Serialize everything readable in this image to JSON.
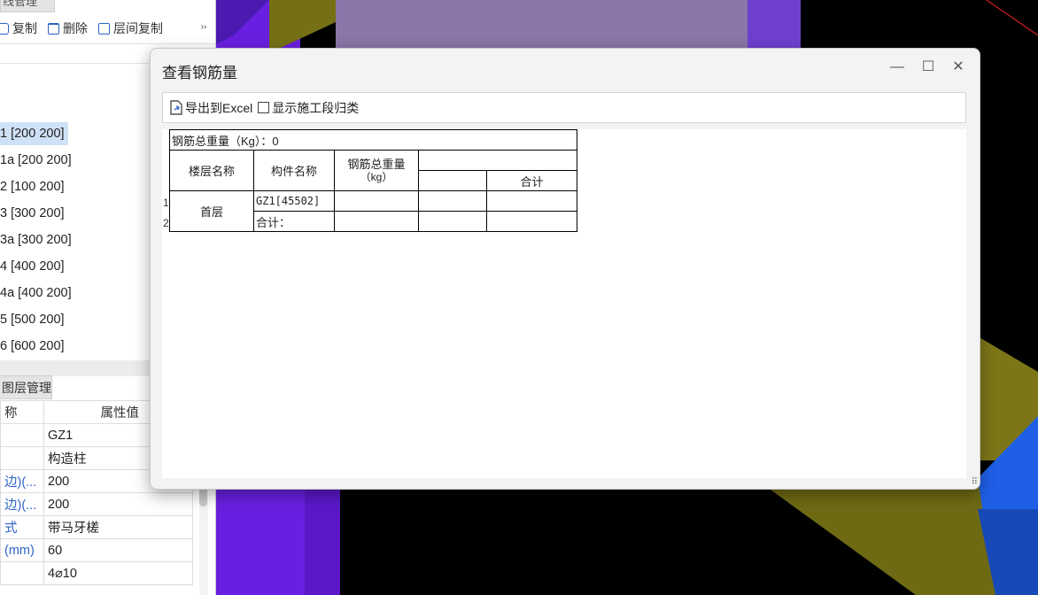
{
  "left_panel": {
    "top_tab": "线管理",
    "toolbar": {
      "copy": "复制",
      "delete": "删除",
      "floor_copy": "层间复制",
      "more": "››"
    },
    "list": [
      "1 [200 200]",
      "1a [200 200]",
      "2 [100 200]",
      "3 [300 200]",
      "3a [300 200]",
      "4 [400 200]",
      "4a [400 200]",
      "5 [500 200]",
      "6 [600 200]"
    ],
    "props_tab": "图层管理",
    "props_header": {
      "name": "称",
      "value": "属性值"
    },
    "props": [
      {
        "key": "",
        "value": "GZ1"
      },
      {
        "key": "",
        "value": "构造柱"
      },
      {
        "key": "边)(...",
        "value": "200"
      },
      {
        "key": "边)(...",
        "value": "200"
      },
      {
        "key": "式",
        "value": "带马牙槎"
      },
      {
        "key": "(mm)",
        "value": "60"
      },
      {
        "key": "",
        "value": "4⌀10"
      }
    ]
  },
  "dialog": {
    "title": "查看钢筋量",
    "win_buttons": {
      "minimize": "—",
      "maximize": "☐",
      "close": "✕"
    },
    "toolbar": {
      "export": "导出到Excel",
      "show_stage": "显示施工段归类"
    },
    "table": {
      "total": "钢筋总重量（Kg）：0",
      "col_floor": "楼层名称",
      "col_component": "构件名称",
      "col_weight": "钢筋总重量",
      "col_weight_unit": "（kg）",
      "col_sum": "合计",
      "row_numbers": [
        "1",
        "2"
      ],
      "floor": "首层",
      "component": "GZ1[45502]",
      "subtotal": "合计："
    }
  },
  "colors": {
    "accent": "#2d63c8",
    "viewport_purple": "#6a1fe0",
    "viewport_olive": "#757016",
    "viewport_blue": "#1f5fe6",
    "viewport_lilac": "#8a76a8"
  }
}
